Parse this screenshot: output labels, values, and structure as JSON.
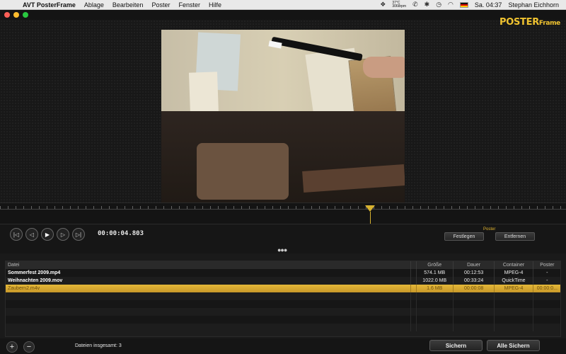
{
  "menubar": {
    "app": "AVT PosterFrame",
    "items": [
      "Ablage",
      "Bearbeiten",
      "Poster",
      "Fenster",
      "Hilfe"
    ],
    "temp_line1": "37°C",
    "temp_line2": "3068rpm",
    "clock": "Sa. 04:37",
    "user": "Stephan Eichhorn"
  },
  "logo": {
    "main": "POSTER",
    "small": "Frame"
  },
  "playback": {
    "timecode": "00:00:04.803"
  },
  "poster": {
    "label": "Poster",
    "set_label": "Festlegen",
    "remove_label": "Entfernen"
  },
  "table": {
    "columns": [
      "Datei",
      "Größe",
      "Dauer",
      "Container",
      "Poster"
    ],
    "rows": [
      {
        "file": "Sommerfest 2009.mp4",
        "size": "574.1 MB",
        "duration": "00:12:53",
        "container": "MPEG-4",
        "poster": "-"
      },
      {
        "file": "Weihnachten 2009.mov",
        "size": "1022.0 MB",
        "duration": "00:33:24",
        "container": "QuickTime",
        "poster": "-"
      },
      {
        "file": "Zaubern2.m4v",
        "size": "1.6 MB",
        "duration": "00:00:08",
        "container": "MPEG-4",
        "poster": "00:00:0..."
      }
    ]
  },
  "footer": {
    "count_label": "Dateien insgesamt: 3",
    "save_label": "Sichern",
    "save_all_label": "Alle Sichern"
  },
  "colors": {
    "accent": "#e4b838",
    "background": "#1c1c1c"
  }
}
